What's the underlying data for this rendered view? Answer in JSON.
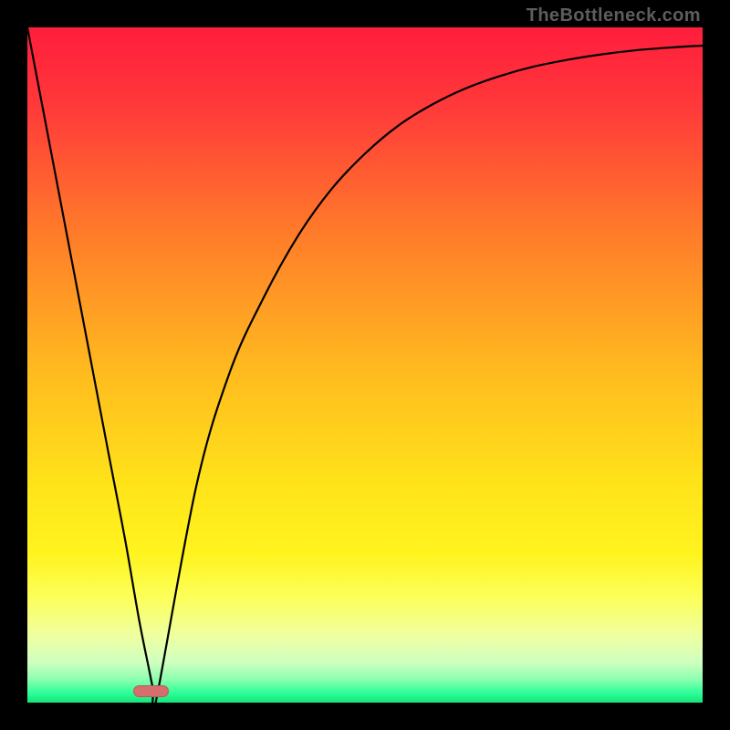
{
  "attribution": "TheBottleneck.com",
  "gradient": {
    "stops": [
      {
        "offset": 0.0,
        "color": "#ff1d3c"
      },
      {
        "offset": 0.12,
        "color": "#ff3a3a"
      },
      {
        "offset": 0.3,
        "color": "#ff7a2a"
      },
      {
        "offset": 0.5,
        "color": "#ffb81f"
      },
      {
        "offset": 0.68,
        "color": "#ffe41a"
      },
      {
        "offset": 0.78,
        "color": "#fff41e"
      },
      {
        "offset": 0.845,
        "color": "#fcff5a"
      },
      {
        "offset": 0.9,
        "color": "#efffa0"
      },
      {
        "offset": 0.94,
        "color": "#cfffc0"
      },
      {
        "offset": 0.965,
        "color": "#8effb0"
      },
      {
        "offset": 0.985,
        "color": "#2fff9a"
      },
      {
        "offset": 1.0,
        "color": "#15e47a"
      }
    ]
  },
  "marker": {
    "x_frac": 0.183,
    "y_frac": 0.983,
    "w_frac": 0.052,
    "h_frac": 0.018,
    "fill": "#d76e6e",
    "border": "#c25858",
    "border_w": 1
  },
  "chart_data": {
    "type": "line",
    "title": "",
    "xlabel": "",
    "ylabel": "",
    "xlim": [
      0,
      100
    ],
    "ylim": [
      0,
      100
    ],
    "series": [
      {
        "name": "curve",
        "x": [
          0,
          4,
          8,
          12,
          14.5,
          16.5,
          18,
          18.6,
          19,
          25,
          30,
          35,
          40,
          45,
          50,
          55,
          60,
          65,
          70,
          75,
          80,
          85,
          90,
          95,
          100
        ],
        "y": [
          100,
          79,
          58,
          37,
          24,
          12.5,
          5,
          2,
          0,
          32,
          49,
          60,
          69,
          76,
          81.3,
          85.5,
          88.6,
          91,
          92.8,
          94.2,
          95.2,
          96,
          96.6,
          97,
          97.3
        ]
      }
    ],
    "annotations": [
      {
        "kind": "marker-pill",
        "x": 18.3,
        "y": 1.7,
        "color": "#d76e6e"
      }
    ],
    "background": "vertical red→yellow→green gradient"
  }
}
